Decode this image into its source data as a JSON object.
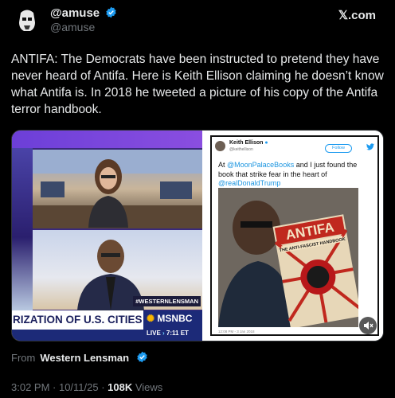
{
  "author": {
    "name": "@amuse",
    "handle": "@amuse"
  },
  "brand": "𝕏.com",
  "tweet_text": "ANTIFA: The Democrats have been instructed to pretend they have never heard of Antifa. Here is Keith Ellison claiming he doesn’t know what Antifa is. In 2018 he tweeted a picture of his copy of the Antifa terror handbook.",
  "media": {
    "left": {
      "chyron": "RIZATION OF U.S. CITIES",
      "chyron_tag": "#WESTERNLENSMAN",
      "network": "MSNBC",
      "live_label": "LIVE",
      "live_time": "7:11 ET"
    },
    "right": {
      "name": "Keith Ellison",
      "handle": "@keithellison",
      "follow_label": "Follow",
      "text_pre": "At ",
      "mention1": "@MoonPalaceBooks",
      "text_mid": " and I just found the book that strike fear in the heart of ",
      "mention2": "@realDonaldTrump",
      "book_title": "ANTIFA",
      "book_subtitle": "THE ANTI-FASCIST HANDBOOK",
      "date": "12:08 PM - 3 Jan 2018"
    }
  },
  "from": {
    "label": "From",
    "name": "Western Lensman"
  },
  "meta": {
    "time_date": "3:02 PM · 10/11/25 · ",
    "views_count": "108K",
    "views_label": " Views"
  },
  "colors": {
    "verified": "#1d9bf0",
    "background": "#000000",
    "text": "#e7e9ea",
    "muted": "#71767b"
  }
}
